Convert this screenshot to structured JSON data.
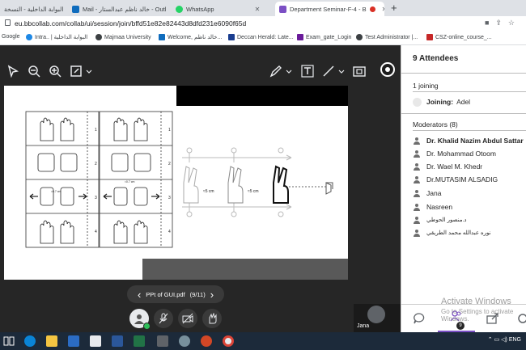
{
  "browser": {
    "tabs": [
      {
        "label": "البوابة الداخلية - النسخة",
        "color": "#1a73e8"
      },
      {
        "label": "Mail - خالد ناظم عبدالستار - Outl",
        "color": "#0f6cbd"
      },
      {
        "label": "WhatsApp",
        "color": "#25d366"
      },
      {
        "label": "Department Seminar-F-4 - B",
        "color": "#7b4fc4",
        "active": true
      }
    ],
    "new_tab": "+",
    "url": "eu.bbcollab.com/collab/ui/session/join/bffd51e82e82443d8dfd231e6090f65d",
    "bookmarks": [
      "Google",
      "Intra.. | البوابة الداخلية",
      "Majmaa University",
      "Welcome, خالد ناظم...",
      "Deccan Herald: Late...",
      "Exam_gate_Login",
      "Test Administrator |...",
      "CSZ-online_course_..."
    ]
  },
  "toolbar": {
    "icons": [
      "pointer-icon",
      "zoom-out-icon",
      "zoom-in-icon",
      "fit-icon",
      "pen-icon",
      "text-icon",
      "line-icon",
      "shape-icon"
    ]
  },
  "slide": {
    "grid_numbers": [
      "1",
      "2",
      "3",
      "4"
    ],
    "measure_labels": [
      "≈0.7 cm",
      "≈0.7 cm",
      "≈5 cm",
      "≈5 cm"
    ]
  },
  "pdf_nav": {
    "filename": "PPt of GUI.pdf",
    "page": "(9/11)"
  },
  "self_tile": {
    "name": "Jana"
  },
  "panel": {
    "title": "9 Attendees",
    "joining_header": "1 joining",
    "joining_label": "Joining:",
    "joining_name": "Adel",
    "moderators_header": "Moderators (8)",
    "moderators": [
      "Dr. Khalid Nazim Abdul Sattar",
      "Dr. Mohammad Otoom",
      "Dr. Wael M. Khedr",
      "Dr.MUTASIM ALSADIG",
      "Jana",
      "Nasreen",
      "د.منصور الحوطي",
      "نوره عبدالله محمد الطريقي"
    ],
    "badge_count": "9"
  },
  "watermark": {
    "line1": "Activate Windows",
    "line2": "Go to Settings to activate Windows."
  },
  "taskbar": {
    "tray_lang": "ENG"
  }
}
